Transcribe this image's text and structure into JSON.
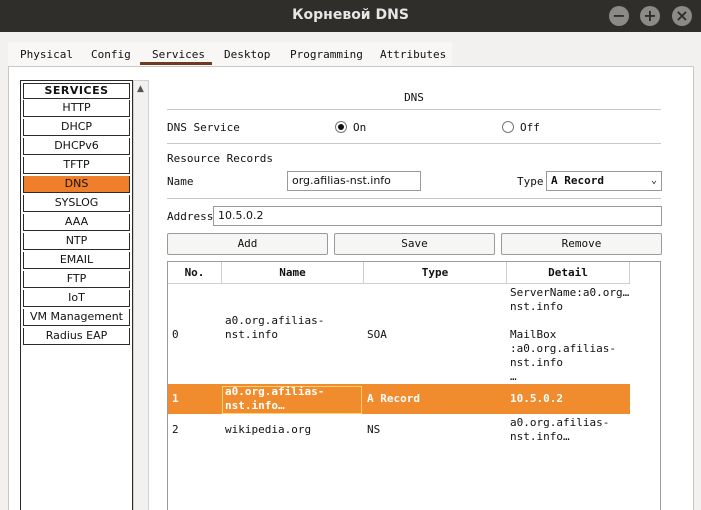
{
  "window": {
    "title": "Корневой DNS",
    "buttons": {
      "minimize": "−",
      "maximize": "+",
      "close": "×"
    }
  },
  "tabs": [
    "Physical",
    "Config",
    "Services",
    "Desktop",
    "Programming",
    "Attributes"
  ],
  "active_tab": "Services",
  "services": {
    "header": "SERVICES",
    "items": [
      "HTTP",
      "DHCP",
      "DHCPv6",
      "TFTP",
      "DNS",
      "SYSLOG",
      "AAA",
      "NTP",
      "EMAIL",
      "FTP",
      "IoT",
      "VM Management",
      "Radius EAP"
    ],
    "selected": "DNS"
  },
  "dns": {
    "section_title": "DNS",
    "service_label": "DNS Service",
    "on_label": "On",
    "off_label": "Off",
    "service_on": true,
    "resource_records_label": "Resource Records",
    "name_label": "Name",
    "name_value": "org.afilias-nst.info",
    "type_label": "Type",
    "type_value": "A Record",
    "address_label": "Address",
    "address_value": "10.5.0.2",
    "add_label": "Add",
    "save_label": "Save",
    "remove_label": "Remove"
  },
  "table": {
    "headers": [
      "No.",
      "Name",
      "Type",
      "Detail"
    ],
    "rows": [
      {
        "no": "0",
        "name": "a0.org.afilias-\nnst.info",
        "type": "SOA",
        "detail": "ServerName:a0.org…\nnst.info\n\nMailBox\n:a0.org.afilias-\nnst.info\n…"
      },
      {
        "no": "1",
        "name": "a0.org.afilias-\nnst.info…",
        "type": "A Record",
        "detail": "10.5.0.2"
      },
      {
        "no": "2",
        "name": "wikipedia.org",
        "type": "NS",
        "detail": "a0.org.afilias-\nnst.info…"
      }
    ],
    "selected_row": 1
  }
}
